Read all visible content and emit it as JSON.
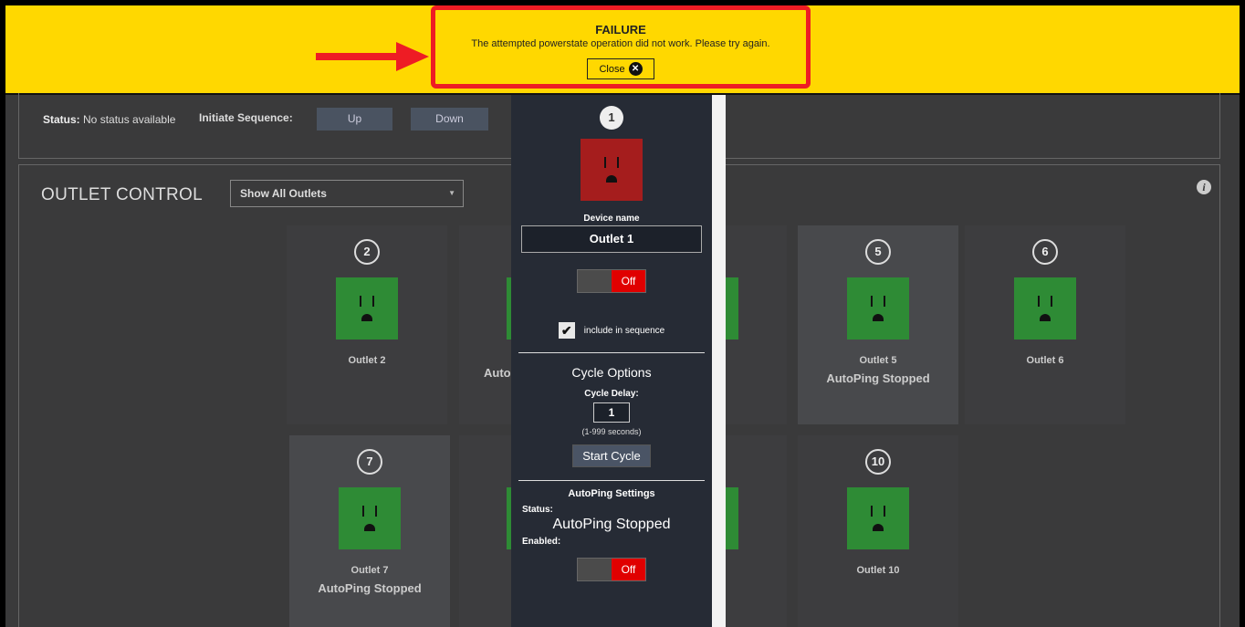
{
  "banner": {
    "title": "FAILURE",
    "message": "The attempted powerstate operation did not work. Please try again.",
    "close_label": "Close",
    "close_icon": "x-circle-icon"
  },
  "status": {
    "label": "Status:",
    "value": "No status available",
    "sequence_label": "Initiate Sequence:",
    "up_label": "Up",
    "down_label": "Down"
  },
  "outlet_control": {
    "title": "OUTLET CONTROL",
    "filter_value": "Show All Outlets",
    "info_icon": "info-icon"
  },
  "tiles": [
    {
      "num": "2",
      "name": "Outlet 2",
      "autoping": ""
    },
    {
      "num": "5",
      "name": "Outlet 5",
      "autoping": "AutoPing Stopped"
    },
    {
      "num": "6",
      "name": "Outlet 6",
      "autoping": ""
    },
    {
      "num": "7",
      "name": "Outlet 7",
      "autoping": "AutoPing Stopped"
    },
    {
      "num": "10",
      "name": "Outlet 10",
      "autoping": ""
    }
  ],
  "partial": {
    "autoping_fragment": "AutoP"
  },
  "edit_panel": {
    "num": "1",
    "device_name_label": "Device name",
    "device_name_value": "Outlet 1",
    "power_state": "Off",
    "include_label": "include in sequence",
    "include_checked": true,
    "cycle_options_title": "Cycle Options",
    "cycle_delay_label": "Cycle Delay:",
    "cycle_delay_value": "1",
    "cycle_delay_hint": "(1-999 seconds)",
    "start_cycle_label": "Start Cycle",
    "autoping_title": "AutoPing Settings",
    "status_label": "Status:",
    "status_value": "AutoPing Stopped",
    "enabled_label": "Enabled:",
    "enabled_state": "Off"
  },
  "colors": {
    "banner": "#ffd800",
    "alert_border": "#ee1c24",
    "outlet_on": "#2e8b35",
    "outlet_off": "#a51d1d",
    "toggle_off": "#e00000"
  }
}
